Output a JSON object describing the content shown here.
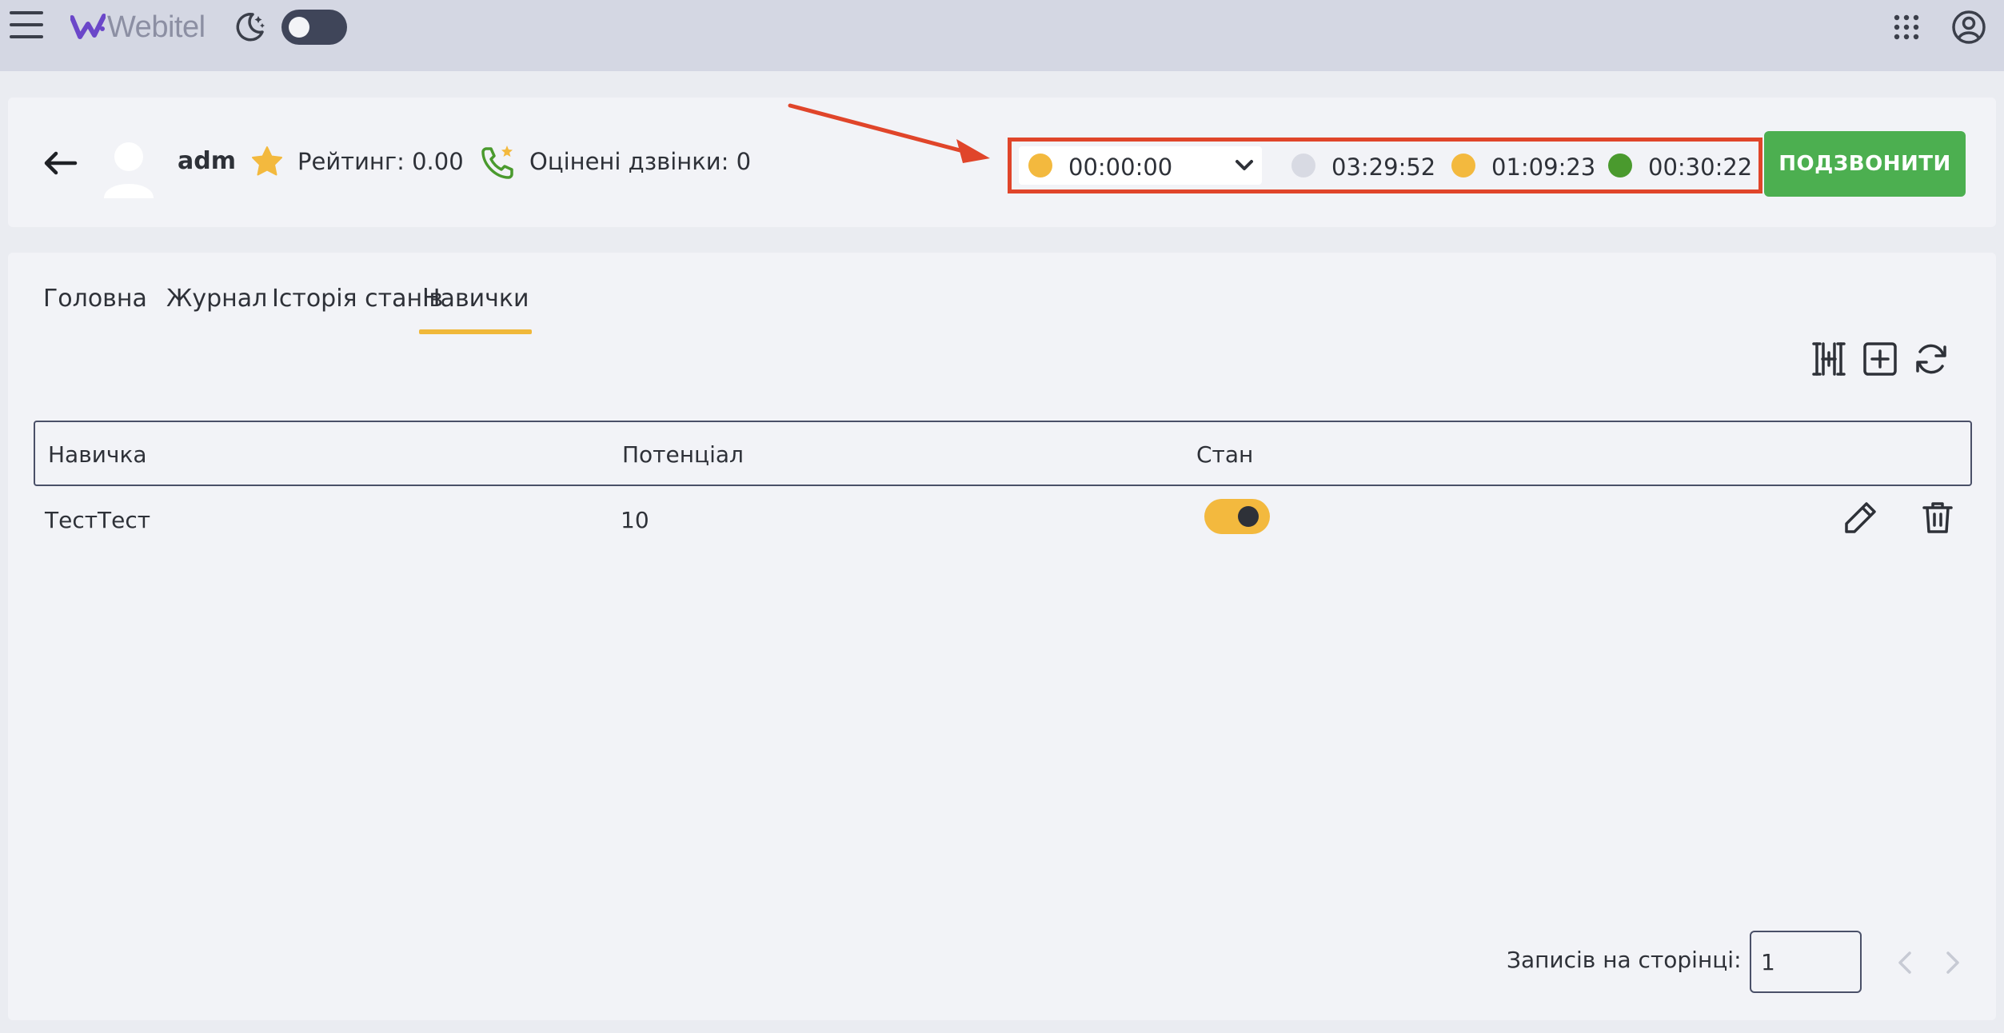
{
  "topbar": {
    "logo_text": "Webitel",
    "icons": {
      "menu": "hamburger-icon",
      "theme": "moon-stars-icon",
      "apps": "grid-apps-icon",
      "account": "account-circle-icon"
    }
  },
  "agent": {
    "name": "adm",
    "rating_label": "Рейтинг: 0.00",
    "rated_calls_label": "Оцінені дзвінки: 0"
  },
  "status": {
    "current": {
      "value": "00:00:00",
      "color": "#f3b93e"
    },
    "stats": [
      {
        "value": "03:29:52",
        "color": "#d8dae3"
      },
      {
        "value": "01:09:23",
        "color": "#f3b93e"
      },
      {
        "value": "00:30:22",
        "color": "#4a9a2e"
      }
    ]
  },
  "call_button": {
    "label": "ПОДЗВОНИТИ",
    "color": "#4caf50"
  },
  "tabs": [
    {
      "label": "Головна",
      "active": false
    },
    {
      "label": "Журнал",
      "active": false
    },
    {
      "label": "Історія станів",
      "active": false
    },
    {
      "label": "Навички",
      "active": true
    }
  ],
  "table": {
    "headers": [
      "Навичка",
      "Потенціал",
      "Стан"
    ],
    "rows": [
      {
        "skill": "ТестТест",
        "capacity": "10",
        "enabled": true
      }
    ]
  },
  "pagination": {
    "per_page_label": "Записів на сторінці:",
    "per_page_value": "1"
  },
  "accent_color": "#f0b83a",
  "annotation_color": "#e0452a"
}
